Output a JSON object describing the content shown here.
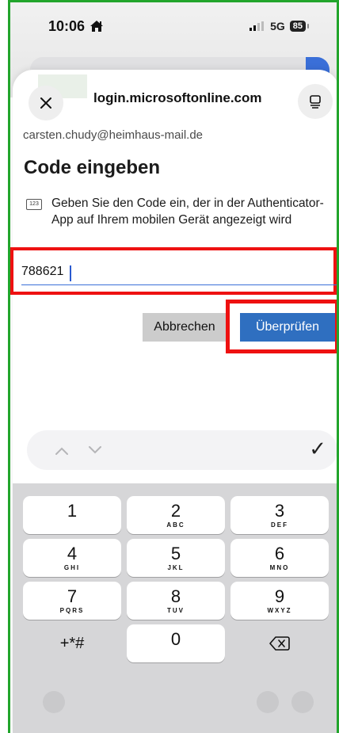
{
  "status": {
    "time": "10:06",
    "network": "5G",
    "battery": "85"
  },
  "browser": {
    "url": "login.microsoftonline.com"
  },
  "page": {
    "account": "carsten.chudy@heimhaus-mail.de",
    "heading": "Code eingeben",
    "instruction": "Geben Sie den Code ein, der in der Authenticator-App auf Ihrem mobilen Gerät angezeigt wird",
    "instruction_badge": "123",
    "code_value": "788621",
    "cancel_label": "Abbrechen",
    "verify_label": "Überprüfen"
  },
  "accessory": {
    "done_symbol": "✓"
  },
  "keypad": {
    "keys": [
      {
        "num": "1",
        "letters": ""
      },
      {
        "num": "2",
        "letters": "ABC"
      },
      {
        "num": "3",
        "letters": "DEF"
      },
      {
        "num": "4",
        "letters": "GHI"
      },
      {
        "num": "5",
        "letters": "JKL"
      },
      {
        "num": "6",
        "letters": "MNO"
      },
      {
        "num": "7",
        "letters": "PQRS"
      },
      {
        "num": "8",
        "letters": "TUV"
      },
      {
        "num": "9",
        "letters": "WXYZ"
      },
      {
        "num": "0",
        "letters": ""
      }
    ],
    "symbols_label": "+*#"
  },
  "colors": {
    "primary_button": "#2f6fc0",
    "annotation_red": "#ee1111",
    "annotation_green": "#22a52c"
  }
}
